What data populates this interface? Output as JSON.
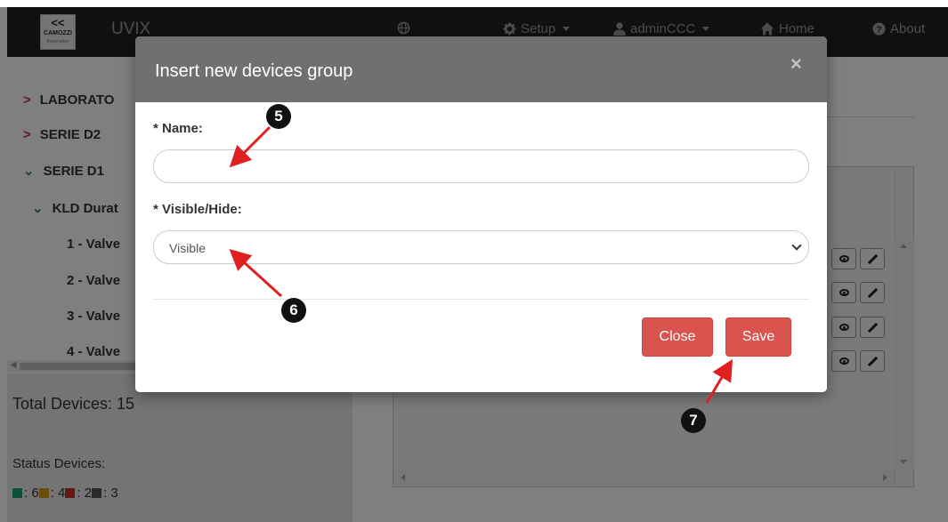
{
  "navbar": {
    "logo": {
      "mark": "<<",
      "name": "CAMOZZI",
      "sub": "Automation"
    },
    "brand": "UVIX",
    "items": [
      {
        "label": "",
        "icon": "globe-icon"
      },
      {
        "label": "Setup",
        "icon": "gear-icon"
      },
      {
        "label": "adminCCC",
        "icon": "user-icon"
      },
      {
        "label": "Home",
        "icon": "home-icon"
      },
      {
        "label": "About",
        "icon": "question-icon"
      }
    ]
  },
  "sidebar": {
    "tree": [
      {
        "label": "LABORATO",
        "state": "collapsed"
      },
      {
        "label": "SERIE D2",
        "state": "collapsed"
      },
      {
        "label": "SERIE D1",
        "state": "expanded"
      },
      {
        "label": "KLD Durat",
        "state": "expanded"
      },
      {
        "label": "1 - Valve"
      },
      {
        "label": "2 - Valve"
      },
      {
        "label": "3 - Valve"
      },
      {
        "label": "4 - Valve"
      }
    ],
    "total_devices": "Total Devices: 15",
    "status_label": "Status Devices:",
    "status_counts": [
      {
        "color": "#1a9e77",
        "text": ": 6 "
      },
      {
        "color": "#d69a16",
        "text": ": 4 "
      },
      {
        "color": "#c9302c",
        "text": ": 2 "
      },
      {
        "color": "#555555",
        "text": ": 3"
      }
    ]
  },
  "modal": {
    "title": "Insert new devices group",
    "close_glyph": "×",
    "name_label": "* Name:",
    "name_value": "",
    "visibility_label": "* Visible/Hide:",
    "visibility_value": "Visible",
    "close_button": "Close",
    "save_button": "Save"
  },
  "annotations": {
    "badge5": "5",
    "badge6": "6",
    "badge7": "7",
    "arrow_color": "#e02020"
  }
}
